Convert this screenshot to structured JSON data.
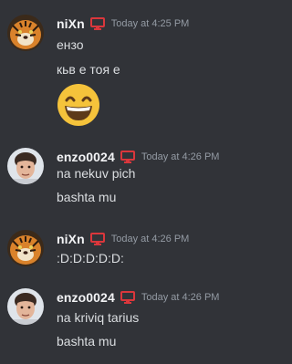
{
  "messages": [
    {
      "username": "niXn",
      "timestamp": "Today at 4:25 PM",
      "role_icon": "monitor-icon",
      "avatar": "tiger-avatar",
      "lines": [
        "ензо",
        "кьв е тоя е"
      ],
      "emoji": "grinning-face-with-smiling-eyes"
    },
    {
      "username": "enzo0024",
      "timestamp": "Today at 4:26 PM",
      "role_icon": "monitor-icon",
      "avatar": "person-avatar",
      "lines": [
        "na nekuv pich",
        "bashta mu"
      ]
    },
    {
      "username": "niXn",
      "timestamp": "Today at 4:26 PM",
      "role_icon": "monitor-icon",
      "avatar": "tiger-avatar",
      "lines": [
        ":D:D:D:D:D:"
      ]
    },
    {
      "username": "enzo0024",
      "timestamp": "Today at 4:26 PM",
      "role_icon": "monitor-icon",
      "avatar": "person-avatar",
      "lines": [
        "na kriviq tarius",
        "bashta mu"
      ]
    }
  ],
  "colors": {
    "background": "#313338",
    "username": "#f2f3f5",
    "timestamp": "#949ba4",
    "text": "#dbdee1",
    "role_icon": "#da373c"
  }
}
